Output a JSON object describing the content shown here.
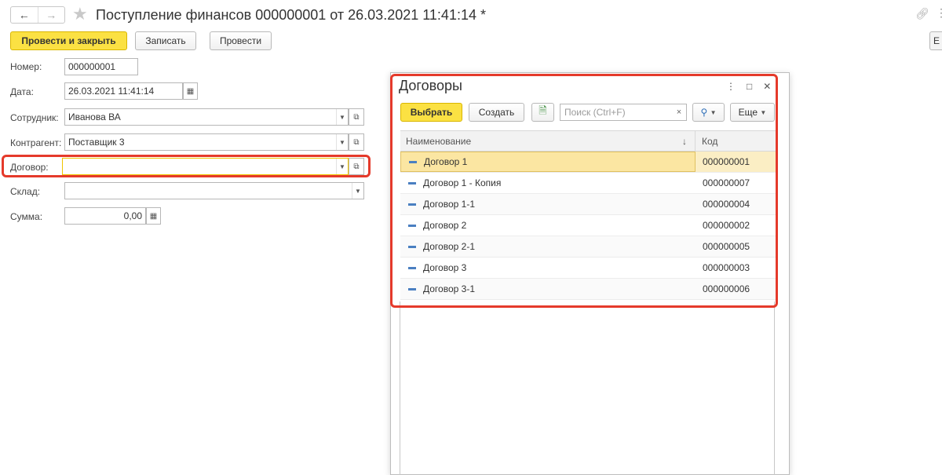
{
  "header": {
    "title": "Поступление финансов 000000001 от 26.03.2021 11:41:14 *",
    "back_icon": "arrow-left",
    "forward_icon": "arrow-right",
    "favorite_icon": "star",
    "link_icon": "link",
    "more_icon": "vertical-dots",
    "right_edge_label": "Е"
  },
  "toolbar": {
    "post_close_label": "Провести и закрыть",
    "save_label": "Записать",
    "post_label": "Провести"
  },
  "form": {
    "number": {
      "label": "Номер:",
      "value": "000000001"
    },
    "date": {
      "label": "Дата:",
      "value": "26.03.2021 11:41:14"
    },
    "employee": {
      "label": "Сотрудник:",
      "value": "Иванова ВА"
    },
    "counterparty": {
      "label": "Контрагент:",
      "value": "Поставщик 3"
    },
    "contract": {
      "label": "Договор:",
      "value": ""
    },
    "warehouse": {
      "label": "Склад:",
      "value": ""
    },
    "amount": {
      "label": "Сумма:",
      "value": "0,00"
    }
  },
  "popup": {
    "title": "Договоры",
    "select_label": "Выбрать",
    "create_label": "Создать",
    "search_placeholder": "Поиск (Ctrl+F)",
    "more_label": "Еще",
    "columns": {
      "name": "Наименование",
      "code": "Код"
    },
    "sort_indicator": "↓",
    "rows": [
      {
        "name": "Договор 1",
        "code": "000000001",
        "selected": true
      },
      {
        "name": "Договор 1 - Копия",
        "code": "000000007"
      },
      {
        "name": "Договор 1-1",
        "code": "000000004"
      },
      {
        "name": "Договор 2",
        "code": "000000002"
      },
      {
        "name": "Договор 2-1",
        "code": "000000005"
      },
      {
        "name": "Договор 3",
        "code": "000000003"
      },
      {
        "name": "Договор 3-1",
        "code": "000000006"
      }
    ]
  },
  "colors": {
    "primary_button": "#fbe143",
    "highlight": "#e53a2b",
    "selected_row": "#fbe6a2",
    "row_marker": "#4a7fc1"
  }
}
